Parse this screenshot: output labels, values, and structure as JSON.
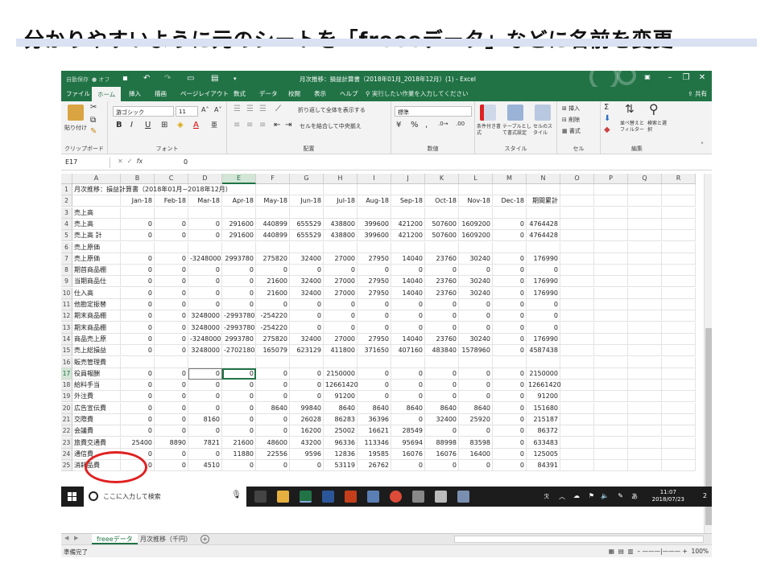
{
  "slide": {
    "title": "分かりやすいように元のシートを「freeeデータ」などに名前を変更"
  },
  "excel": {
    "autosave": "自動保存",
    "autosave_state": "● オフ",
    "window_title": "月次推移：損益計算書（2018年01月_2018年12月）(1) - Excel",
    "ribbon_tabs": [
      "ファイル",
      "ホーム",
      "挿入",
      "描画",
      "ページレイアウト",
      "数式",
      "データ",
      "校閲",
      "表示",
      "ヘルプ"
    ],
    "active_tab": "ホーム",
    "tell_me": "実行したい作業を入力してください",
    "share": "共有",
    "ribbon": {
      "clipboard": {
        "label": "クリップボード",
        "paste": "貼り付け"
      },
      "font": {
        "label": "フォント",
        "name": "游ゴシック",
        "size": "11"
      },
      "alignment": {
        "label": "配置",
        "wrap": "折り返して全体を表示する",
        "merge": "セルを結合して中央揃え"
      },
      "number": {
        "label": "数値",
        "format": "標準"
      },
      "styles": {
        "label": "スタイル",
        "cond": "条件付き書式",
        "table": "テーブルとして書式設定",
        "cell": "セルのスタイル"
      },
      "cells": {
        "label": "セル",
        "insert": "挿入",
        "delete": "削除",
        "format": "書式"
      },
      "editing": {
        "label": "編集",
        "sort": "並べ替えとフィルター",
        "find": "検索と選択"
      }
    },
    "name_box": "E17",
    "formula_value": "0",
    "col_headers": [
      "A",
      "B",
      "C",
      "D",
      "E",
      "F",
      "G",
      "H",
      "I",
      "J",
      "K",
      "L",
      "M",
      "N",
      "O",
      "P",
      "Q",
      "R"
    ],
    "rows": [
      [
        "月次推移：損益計算書（2018年01月~2018年12月）",
        "",
        "",
        "",
        "",
        "",
        "",
        "",
        "",
        "",
        "",
        "",
        "",
        ""
      ],
      [
        "",
        "Jan-18",
        "Feb-18",
        "Mar-18",
        "Apr-18",
        "May-18",
        "Jun-18",
        "Jul-18",
        "Aug-18",
        "Sep-18",
        "Oct-18",
        "Nov-18",
        "Dec-18",
        "期間累計"
      ],
      [
        "売上高",
        "",
        "",
        "",
        "",
        "",
        "",
        "",
        "",
        "",
        "",
        "",
        "",
        ""
      ],
      [
        "売上高",
        "0",
        "0",
        "0",
        "291600",
        "440899",
        "655529",
        "438800",
        "399600",
        "421200",
        "507600",
        "1609200",
        "0",
        "4764428"
      ],
      [
        "売上高 計",
        "0",
        "0",
        "0",
        "291600",
        "440899",
        "655529",
        "438800",
        "399600",
        "421200",
        "507600",
        "1609200",
        "0",
        "4764428"
      ],
      [
        "売上原価",
        "",
        "",
        "",
        "",
        "",
        "",
        "",
        "",
        "",
        "",
        "",
        "",
        ""
      ],
      [
        "売上原価",
        "0",
        "0",
        "-3248000",
        "2993780",
        "275820",
        "32400",
        "27000",
        "27950",
        "14040",
        "23760",
        "30240",
        "0",
        "176990"
      ],
      [
        "期首商品棚",
        "0",
        "0",
        "0",
        "0",
        "0",
        "0",
        "0",
        "0",
        "0",
        "0",
        "0",
        "0",
        "0"
      ],
      [
        "当期商品仕",
        "0",
        "0",
        "0",
        "0",
        "21600",
        "32400",
        "27000",
        "27950",
        "14040",
        "23760",
        "30240",
        "0",
        "176990"
      ],
      [
        "仕入高",
        "0",
        "0",
        "0",
        "0",
        "21600",
        "32400",
        "27000",
        "27950",
        "14040",
        "23760",
        "30240",
        "0",
        "176990"
      ],
      [
        "他勘定振替",
        "0",
        "0",
        "0",
        "0",
        "0",
        "0",
        "0",
        "0",
        "0",
        "0",
        "0",
        "0",
        "0"
      ],
      [
        "期末商品棚",
        "0",
        "0",
        "3248000",
        "-2993780",
        "-254220",
        "0",
        "0",
        "0",
        "0",
        "0",
        "0",
        "0",
        "0"
      ],
      [
        "期末商品棚",
        "0",
        "0",
        "3248000",
        "-2993780",
        "-254220",
        "0",
        "0",
        "0",
        "0",
        "0",
        "0",
        "0",
        "0"
      ],
      [
        "商品売上原",
        "0",
        "0",
        "-3248000",
        "2993780",
        "275820",
        "32400",
        "27000",
        "27950",
        "14040",
        "23760",
        "30240",
        "0",
        "176990"
      ],
      [
        "売上総損益",
        "0",
        "0",
        "3248000",
        "-2702180",
        "165079",
        "623129",
        "411800",
        "371650",
        "407160",
        "483840",
        "1578960",
        "0",
        "4587438"
      ],
      [
        "販売管理費",
        "",
        "",
        "",
        "",
        "",
        "",
        "",
        "",
        "",
        "",
        "",
        "",
        ""
      ],
      [
        "役員報酬",
        "0",
        "0",
        "0",
        "0",
        "0",
        "0",
        "2150000",
        "0",
        "0",
        "0",
        "0",
        "0",
        "2150000"
      ],
      [
        "給料手当",
        "0",
        "0",
        "0",
        "0",
        "0",
        "0",
        "12661420",
        "0",
        "0",
        "0",
        "0",
        "0",
        "12661420"
      ],
      [
        "外注費",
        "0",
        "0",
        "0",
        "0",
        "0",
        "0",
        "91200",
        "0",
        "0",
        "0",
        "0",
        "0",
        "91200"
      ],
      [
        "広告宣伝費",
        "0",
        "0",
        "0",
        "0",
        "8640",
        "99840",
        "8640",
        "8640",
        "8640",
        "8640",
        "8640",
        "0",
        "151680"
      ],
      [
        "交際費",
        "0",
        "0",
        "8160",
        "0",
        "0",
        "26028",
        "86283",
        "36396",
        "0",
        "32400",
        "25920",
        "0",
        "215187"
      ],
      [
        "会議費",
        "0",
        "0",
        "0",
        "0",
        "0",
        "16200",
        "25002",
        "16621",
        "28549",
        "0",
        "0",
        "0",
        "86372"
      ],
      [
        "旅費交通費",
        "25400",
        "8890",
        "7821",
        "21600",
        "48600",
        "43200",
        "96336",
        "113346",
        "95694",
        "88998",
        "83598",
        "0",
        "633483"
      ],
      [
        "通信費",
        "0",
        "0",
        "0",
        "11880",
        "22556",
        "9596",
        "12836",
        "19585",
        "16076",
        "16076",
        "16400",
        "0",
        "125005"
      ],
      [
        "消耗品費",
        "0",
        "0",
        "4510",
        "0",
        "0",
        "0",
        "53119",
        "26762",
        "0",
        "0",
        "0",
        "0",
        "84391"
      ]
    ],
    "sheet_tabs": [
      "freeeデータ",
      "月次推移（千円）"
    ],
    "status": "準備完了",
    "zoom": "100%"
  },
  "taskbar": {
    "search_placeholder": "ここに入力して検索",
    "time": "11:07",
    "date": "2018/07/23",
    "ime": "あ",
    "notifications": "2"
  }
}
